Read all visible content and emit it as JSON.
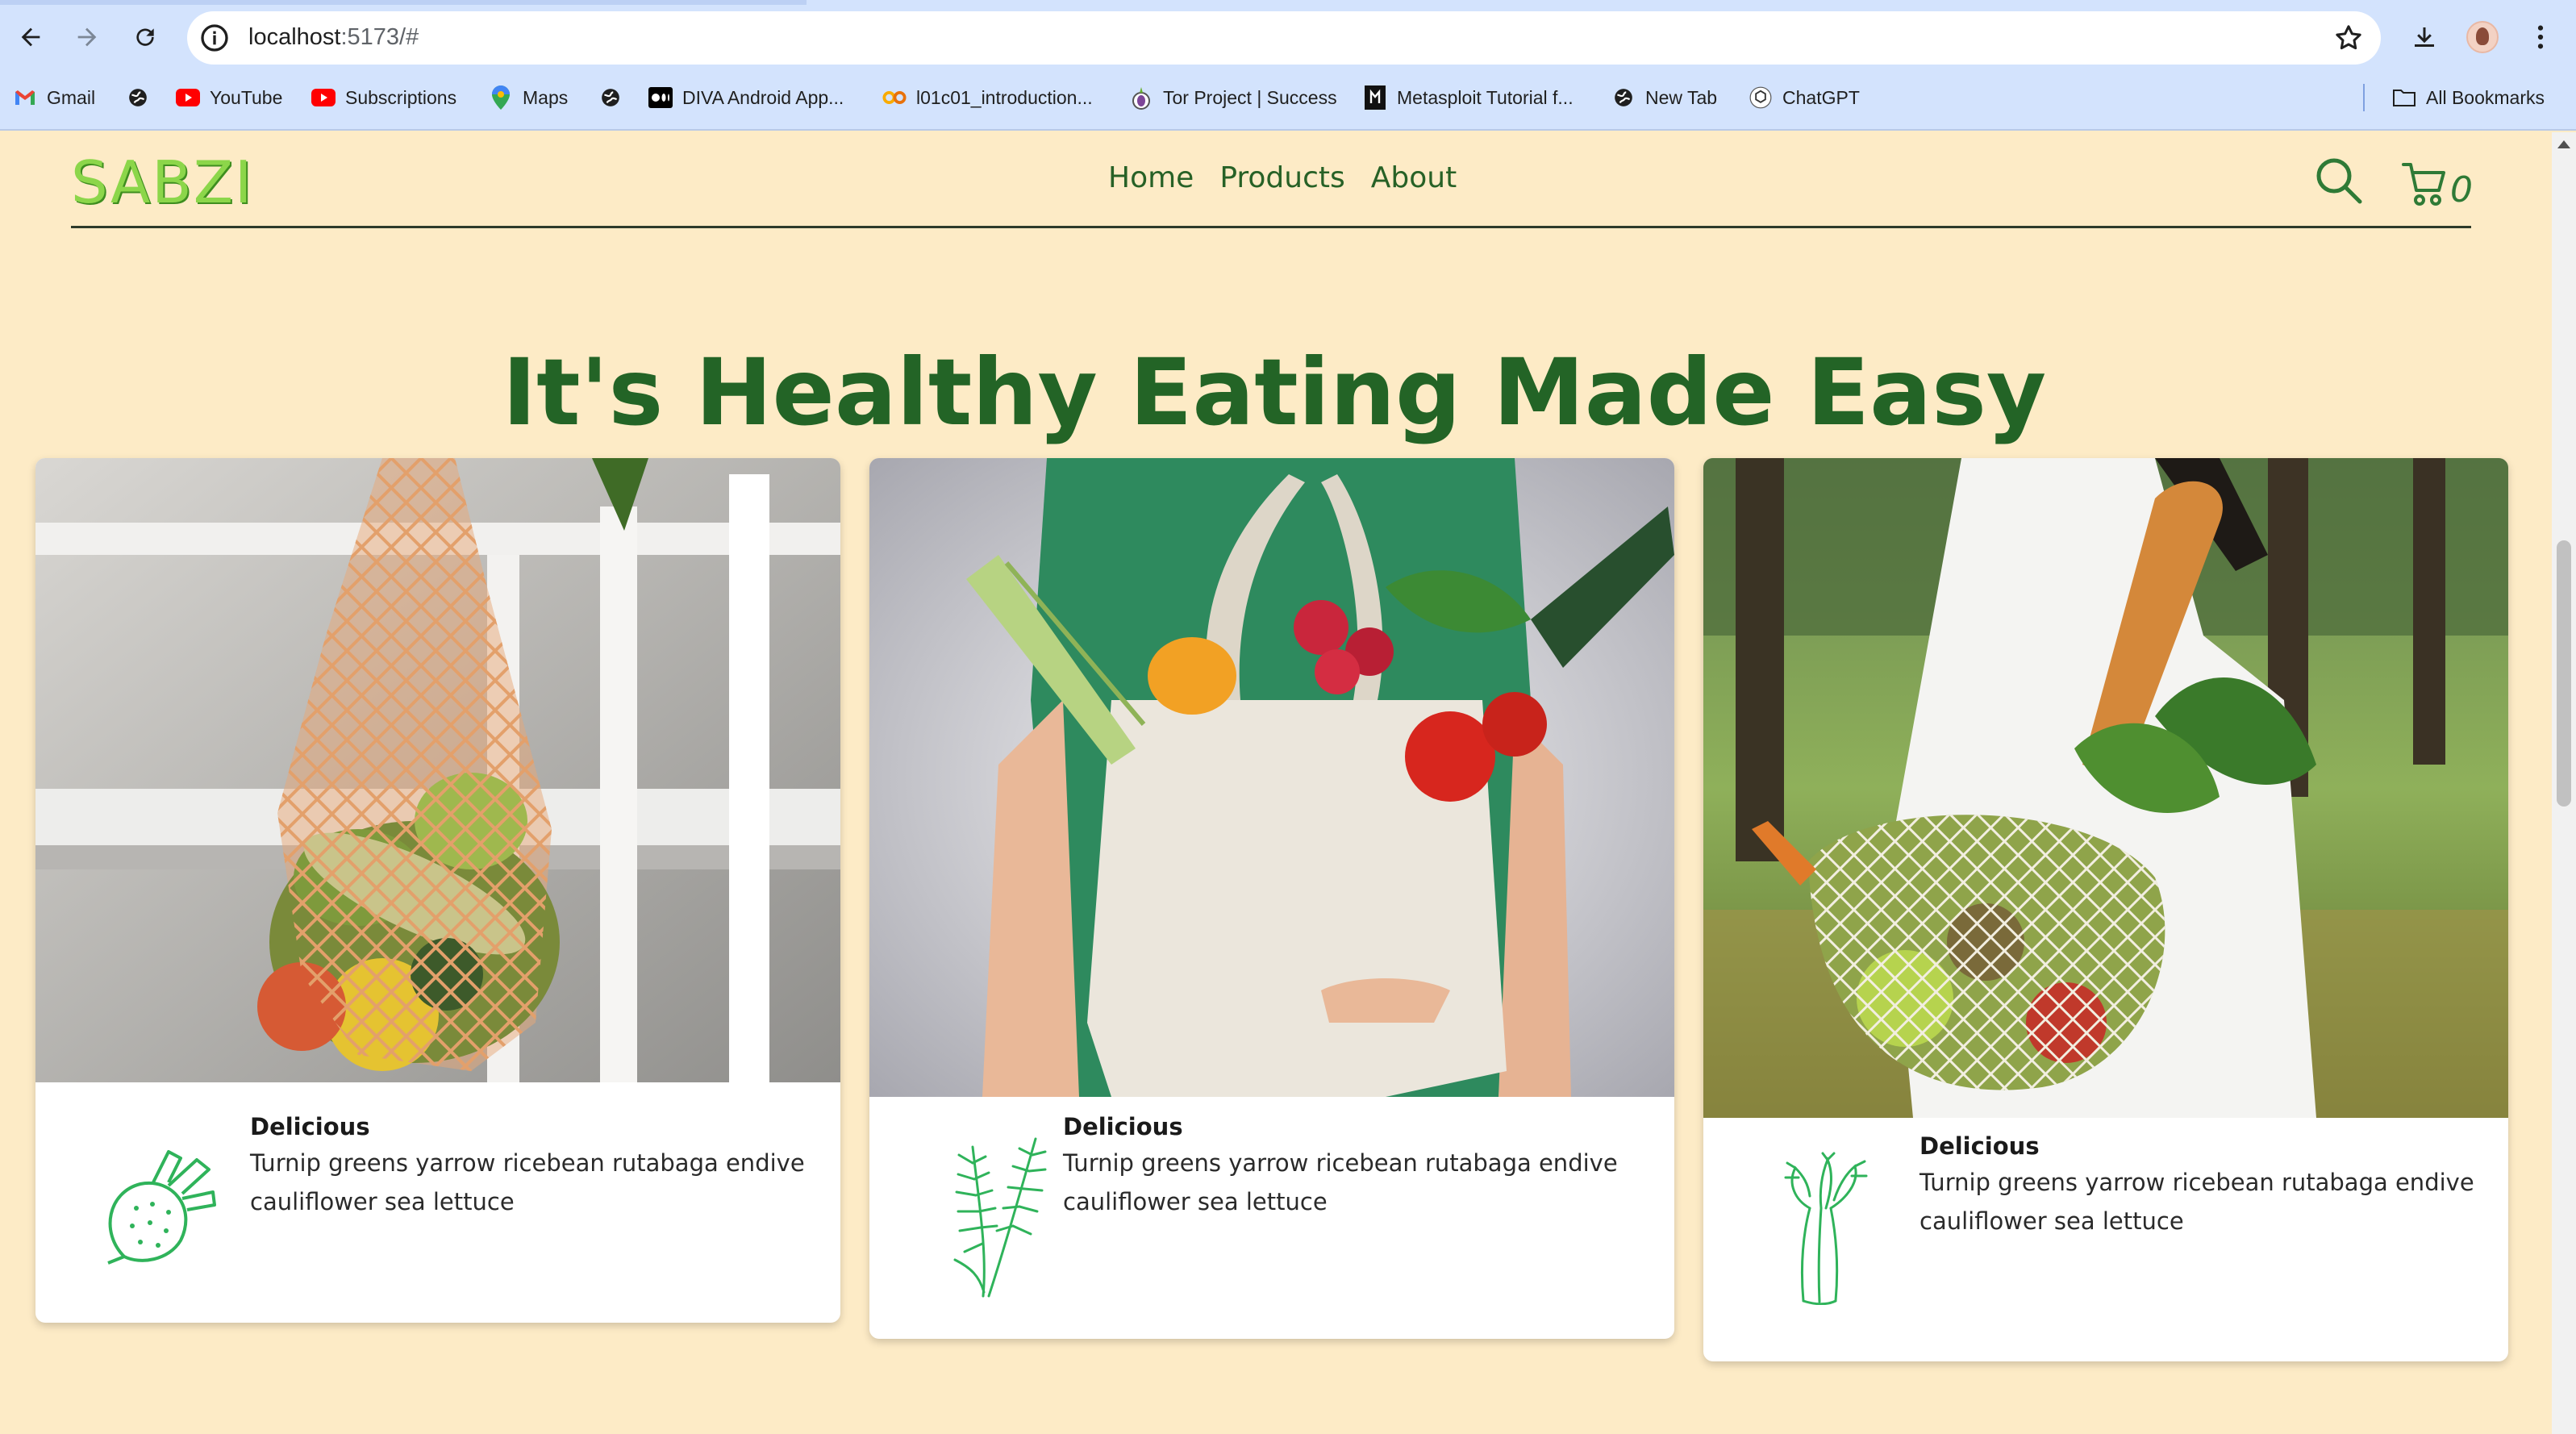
{
  "browser": {
    "url_host": "localhost",
    "url_rest": ":5173/#",
    "bookmarks": [
      {
        "label": "Gmail",
        "icon": "gmail-icon"
      },
      {
        "label": "",
        "icon": "globe-icon"
      },
      {
        "label": "YouTube",
        "icon": "youtube-icon"
      },
      {
        "label": "Subscriptions",
        "icon": "youtube-icon"
      },
      {
        "label": "Maps",
        "icon": "maps-icon"
      },
      {
        "label": "",
        "icon": "globe-icon"
      },
      {
        "label": "DIVA Android App...",
        "icon": "medium-icon"
      },
      {
        "label": "l01c01_introduction...",
        "icon": "colab-icon"
      },
      {
        "label": "Tor Project | Success",
        "icon": "tor-icon"
      },
      {
        "label": "Metasploit Tutorial f...",
        "icon": "metasploit-icon"
      },
      {
        "label": "New Tab",
        "icon": "globe-icon"
      },
      {
        "label": "ChatGPT",
        "icon": "chatgpt-icon"
      }
    ],
    "all_bookmarks": "All Bookmarks"
  },
  "site": {
    "logo": "SABZI",
    "nav": [
      "Home",
      "Products",
      "About"
    ],
    "cart_count": "0",
    "headline": "It's Healthy Eating Made Easy",
    "accent_color": "#236426",
    "background_color": "#fdebc6"
  },
  "cards": [
    {
      "title": "Delicious",
      "text": "Turnip greens yarrow ricebean rutabaga endive cauliflower sea lettuce",
      "icon": "beet-icon",
      "photo": "mesh-bag-fruit-photo"
    },
    {
      "title": "Delicious",
      "text": "Turnip greens yarrow ricebean rutabaga endive cauliflower sea lettuce",
      "icon": "rosemary-icon",
      "photo": "tote-bag-vegetables-photo"
    },
    {
      "title": "Delicious",
      "text": "Turnip greens yarrow ricebean rutabaga endive cauliflower sea lettuce",
      "icon": "celery-icon",
      "photo": "net-bag-groceries-photo"
    }
  ]
}
